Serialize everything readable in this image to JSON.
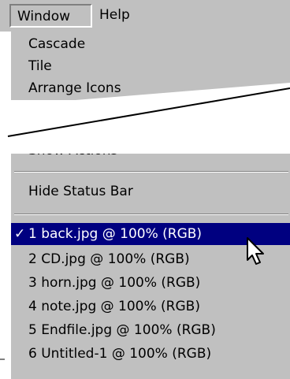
{
  "menubar": {
    "window_label": "Window",
    "help_label": "Help"
  },
  "window_menu": {
    "top_items": [
      "Cascade",
      "Tile",
      "Arrange Icons"
    ],
    "cut_item": "Show Actions",
    "status_item": "Hide Status Bar",
    "check_glyph": "✓",
    "documents": [
      {
        "label": "1 back.jpg @ 100% (RGB)",
        "checked": true
      },
      {
        "label": "2 CD.jpg @ 100% (RGB)",
        "checked": false
      },
      {
        "label": "3 horn.jpg @ 100% (RGB)",
        "checked": false
      },
      {
        "label": "4 note.jpg @ 100% (RGB)",
        "checked": false
      },
      {
        "label": "5 Endfile.jpg @ 100% (RGB)",
        "checked": false
      },
      {
        "label": "6 Untitled-1 @ 100% (RGB)",
        "checked": false
      }
    ]
  },
  "colors": {
    "menu_bg": "#c0c0c0",
    "highlight_bg": "#000080",
    "highlight_text": "#ffffff"
  }
}
